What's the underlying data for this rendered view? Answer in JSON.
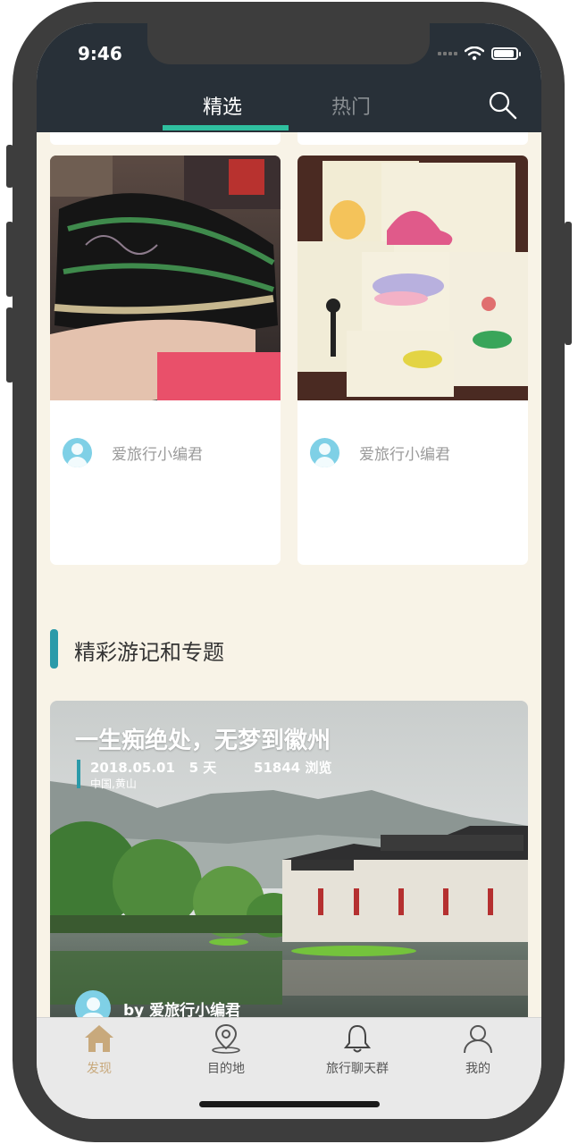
{
  "status_bar": {
    "time": "9:46"
  },
  "header": {
    "tabs": [
      {
        "label": "精选",
        "active": true
      },
      {
        "label": "热门",
        "active": false
      }
    ],
    "search_icon": "search-icon"
  },
  "cards": [
    {
      "author": "爱旅行小编君",
      "image": "embroidered-shoe-photo"
    },
    {
      "author": "爱旅行小编君",
      "image": "watercolor-postcards-photo"
    }
  ],
  "section": {
    "title": "精彩游记和专题"
  },
  "feature": {
    "title": "一生痴绝处，无梦到徽州",
    "date": "2018.05.01",
    "days": "5 天",
    "views": "51844 浏览",
    "location": "中国,黄山",
    "author": "by 爱旅行小编君"
  },
  "tabbar": {
    "items": [
      {
        "label": "发现",
        "icon": "home-icon",
        "active": true
      },
      {
        "label": "目的地",
        "icon": "map-pin-icon",
        "active": false
      },
      {
        "label": "旅行聊天群",
        "icon": "bell-icon",
        "active": false
      },
      {
        "label": "我的",
        "icon": "person-icon",
        "active": false
      }
    ]
  },
  "colors": {
    "header_bg": "#283038",
    "tab_active_underline": "#2fbf9f",
    "page_bg": "#f8f3e7",
    "accent_teal": "#2b9aa9",
    "tab_active_text": "#c8a97c"
  }
}
